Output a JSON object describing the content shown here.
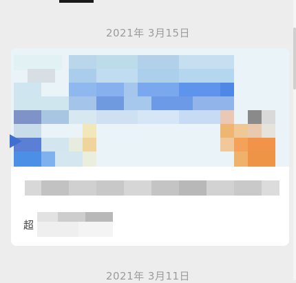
{
  "dates": {
    "first": "2021年 3月15日",
    "second": "2021年 3月11日"
  },
  "card": {
    "source_text": "超"
  },
  "colors": {
    "background": "#ededed",
    "card": "#ffffff",
    "date_text": "#9b9b9b"
  }
}
